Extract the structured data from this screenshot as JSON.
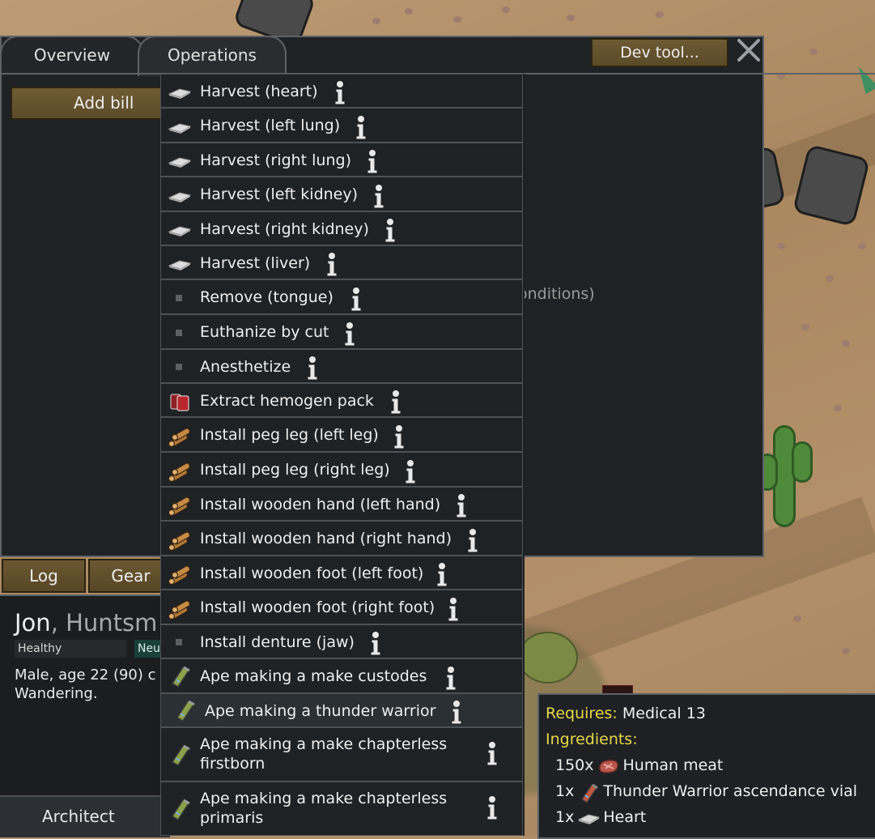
{
  "window": {
    "tabs": [
      {
        "label": "Overview"
      },
      {
        "label": "Operations"
      }
    ],
    "dev_tool_label": "Dev tool...",
    "add_bill_label": "Add bill",
    "background_text": "onditions)"
  },
  "menu": {
    "items": [
      {
        "label": "Harvest (heart)",
        "icon": "organ-icon"
      },
      {
        "label": "Harvest (left lung)",
        "icon": "organ-icon"
      },
      {
        "label": "Harvest (right lung)",
        "icon": "organ-icon"
      },
      {
        "label": "Harvest (left kidney)",
        "icon": "organ-icon"
      },
      {
        "label": "Harvest (right kidney)",
        "icon": "organ-icon"
      },
      {
        "label": "Harvest (liver)",
        "icon": "organ-icon"
      },
      {
        "label": "Remove (tongue)",
        "icon": "small-square-icon"
      },
      {
        "label": "Euthanize by cut",
        "icon": "small-square-icon"
      },
      {
        "label": "Anesthetize",
        "icon": "small-square-icon"
      },
      {
        "label": "Extract hemogen pack",
        "icon": "hemogen-pack-icon"
      },
      {
        "label": "Install peg leg (left leg)",
        "icon": "wood-logs-icon"
      },
      {
        "label": "Install peg leg (right leg)",
        "icon": "wood-logs-icon"
      },
      {
        "label": "Install wooden hand (left hand)",
        "icon": "wood-logs-icon"
      },
      {
        "label": "Install wooden hand (right hand)",
        "icon": "wood-logs-icon"
      },
      {
        "label": "Install wooden foot (left foot)",
        "icon": "wood-logs-icon"
      },
      {
        "label": "Install wooden foot (right foot)",
        "icon": "wood-logs-icon"
      },
      {
        "label": "Install denture (jaw)",
        "icon": "small-square-icon"
      },
      {
        "label": "Ape making a make custodes",
        "icon": "vial-icon"
      },
      {
        "label": "Ape making a thunder warrior",
        "icon": "vial-icon"
      },
      {
        "label": "Ape making a make chapterless firstborn",
        "line1": "Ape making a make chapterless",
        "line2": "firstborn",
        "icon": "vial-icon"
      },
      {
        "label": "Ape making a make chapterless primaris",
        "line1": "Ape making a make chapterless",
        "line2": "primaris",
        "icon": "vial-icon"
      }
    ],
    "highlighted_index": 18
  },
  "bottom": {
    "log_tab": "Log",
    "gear_tab": "Gear",
    "pawn_name": "Jon",
    "pawn_sep": ", ",
    "pawn_title": "Huntsm",
    "health": "Healthy",
    "ideo": "Neu",
    "desc_line1": "Male, age 22 (90) c",
    "desc_line2": "Wandering.",
    "architect": "Architect"
  },
  "tooltip": {
    "requires_label": "Requires:",
    "requires_value": "Medical 13",
    "ingredients_label": "Ingredients:",
    "ingredients": [
      {
        "qty": "150x",
        "name": "Human meat",
        "icon": "meat-icon"
      },
      {
        "qty": "1x",
        "name": "Thunder Warrior ascendance vial",
        "icon": "vial-icon"
      },
      {
        "qty": "1x",
        "name": "Heart",
        "icon": "organ-icon"
      }
    ]
  },
  "colors": {
    "window_bg": "#1f2224",
    "button_brown": "#6d5a33",
    "tooltip_yellow": "#e6d84b"
  }
}
